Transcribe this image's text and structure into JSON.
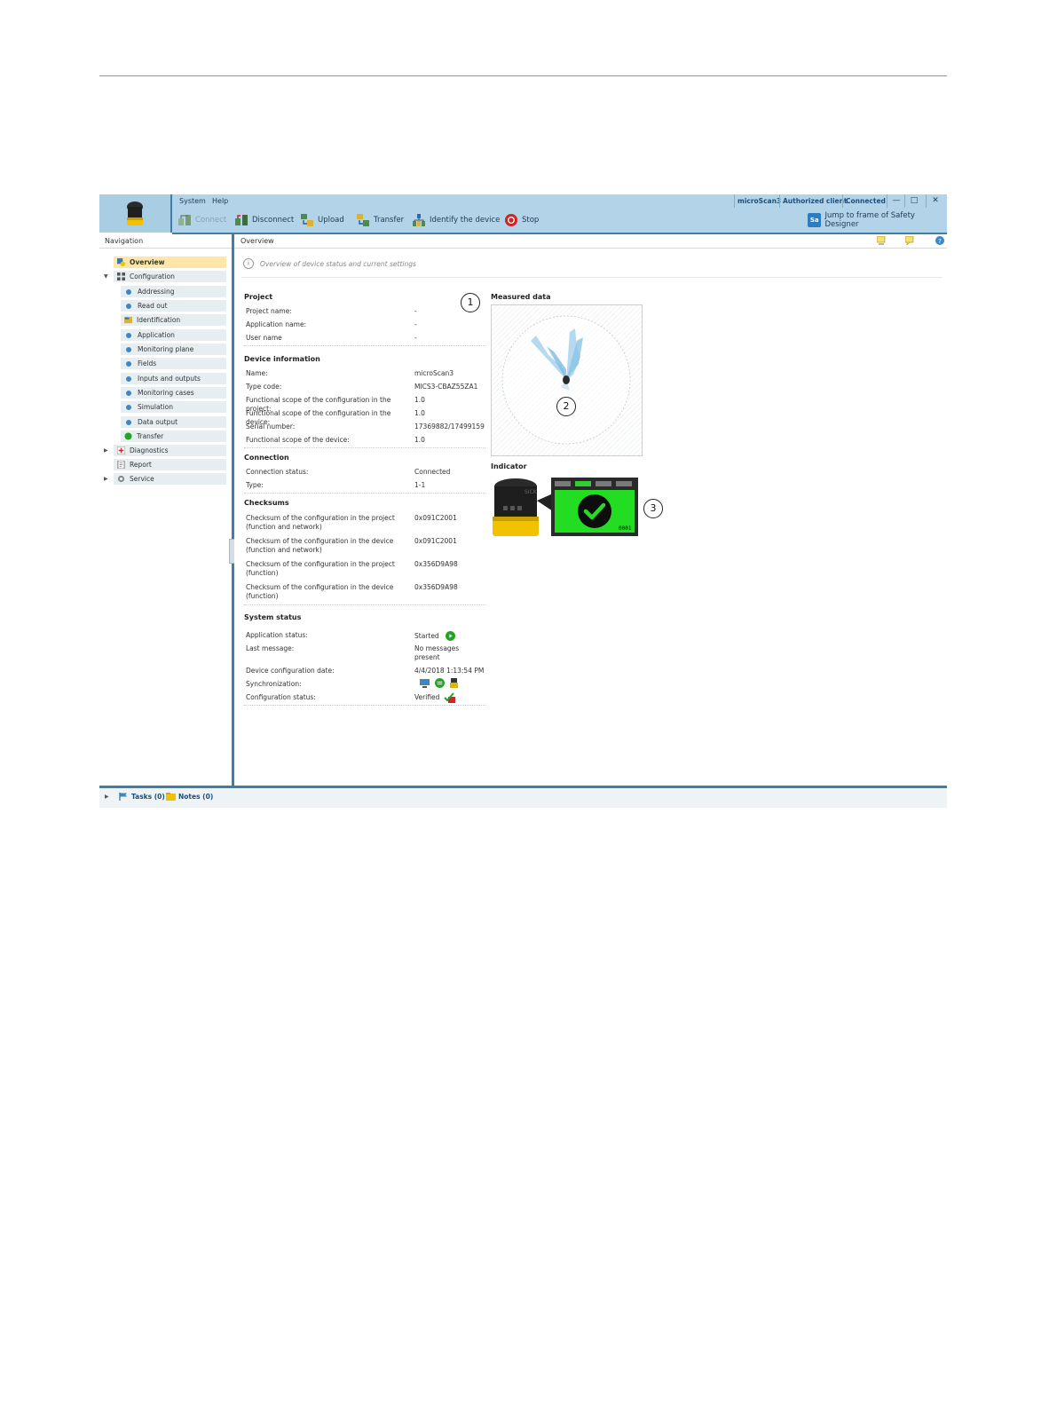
{
  "menu": {
    "system": "System",
    "help": "Help"
  },
  "status": {
    "device": "microScan3",
    "user": "Authorized client",
    "connection": "Connected"
  },
  "window": {
    "minimize": "—",
    "maximize": "□",
    "close": "✕"
  },
  "toolbar": {
    "connect": "Connect",
    "disconnect": "Disconnect",
    "upload": "Upload",
    "transfer": "Transfer",
    "identify": "Identify the device",
    "stop": "Stop",
    "jump": "Jump to frame of Safety Designer",
    "jump_badge": "Sa"
  },
  "navigation": {
    "title": "Navigation",
    "overview": "Overview",
    "configuration": "Configuration",
    "items": [
      "Addressing",
      "Read out",
      "Identification",
      "Application",
      "Monitoring plane",
      "Fields",
      "Inputs and outputs",
      "Monitoring cases",
      "Simulation",
      "Data output",
      "Transfer"
    ],
    "diagnostics": "Diagnostics",
    "report": "Report",
    "service": "Service"
  },
  "overview": {
    "title": "Overview",
    "info": "Overview of device status and current settings"
  },
  "project": {
    "title": "Project",
    "rows": [
      {
        "label": "Project name:",
        "value": "-"
      },
      {
        "label": "Application name:",
        "value": "-"
      },
      {
        "label": "User name",
        "value": "-"
      }
    ]
  },
  "device_info": {
    "title": "Device information",
    "rows": [
      {
        "label": "Name:",
        "value": "microScan3"
      },
      {
        "label": "Type code:",
        "value": "MICS3-CBAZ55ZA1"
      },
      {
        "label": "Functional scope of the configuration in the project:",
        "value": "1.0"
      },
      {
        "label": "Functional scope of the configuration in the device:",
        "value": "1.0"
      },
      {
        "label": "Serial number:",
        "value": "17369882/17499159"
      },
      {
        "label": "Functional scope of the device:",
        "value": "1.0"
      }
    ]
  },
  "connection": {
    "title": "Connection",
    "rows": [
      {
        "label": "Connection status:",
        "value": "Connected"
      },
      {
        "label": "Type:",
        "value": "1-1"
      }
    ]
  },
  "checksums": {
    "title": "Checksums",
    "rows": [
      {
        "label": "Checksum of the configuration in the project (function and network)",
        "value": "0x091C2001"
      },
      {
        "label": "Checksum of the configuration in the device (function and network)",
        "value": "0x091C2001"
      },
      {
        "label": "Checksum of the configuration in the project (function)",
        "value": "0x356D9A98"
      },
      {
        "label": "Checksum of the configuration in the device (function)",
        "value": "0x356D9A98"
      }
    ]
  },
  "system_status": {
    "title": "System status",
    "rows": [
      {
        "label": "Application status:",
        "value": "Started"
      },
      {
        "label": "Last message:",
        "value": "No messages present"
      },
      {
        "label": "Device configuration date:",
        "value": "4/4/2018 1:13:54 PM"
      },
      {
        "label": "Synchronization:",
        "value": ""
      },
      {
        "label": "Configuration status:",
        "value": "Verified"
      }
    ]
  },
  "measured": {
    "title": "Measured data"
  },
  "indicator": {
    "title": "Indicator",
    "display_code": "0001",
    "brand": "SICK"
  },
  "callouts": [
    "1",
    "2",
    "3"
  ],
  "bottom": {
    "tasks": "Tasks (0)",
    "notes": "Notes (0)"
  },
  "colors": {
    "accent": "#3d7fa8",
    "toolbar": "#b3d4e8",
    "selected": "#fde7a8",
    "ok_green": "#22c122"
  }
}
